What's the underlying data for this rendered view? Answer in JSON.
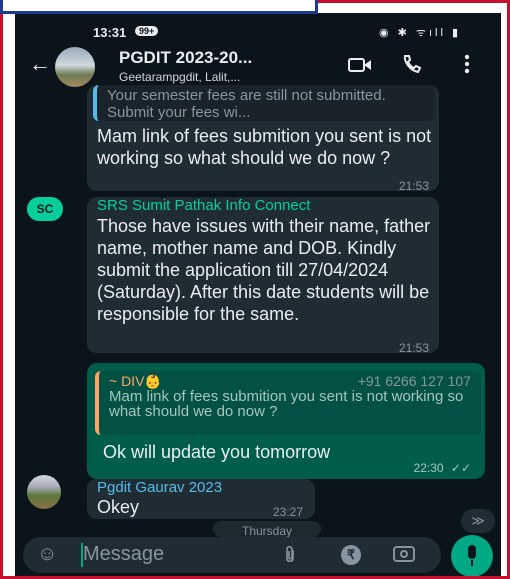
{
  "status_bar": {
    "time": "13:31",
    "badge": "99+",
    "icons": "◉ ✱ ᯤıll ▮"
  },
  "header": {
    "back_icon": "←",
    "title": "PGDIT 2023-20...",
    "subtitle": "Geetarampgdit, Lalit,...",
    "video_icon": "video-call-icon",
    "call_icon": "phone-icon",
    "menu_icon": "more-vertical-icon"
  },
  "messages": [
    {
      "direction": "incoming",
      "quote_text": "Your semester fees are still not submitted. Submit your fees wi...",
      "text": "Mam link of fees submition you sent is not working so what should we do now ?",
      "time": "21:53"
    },
    {
      "direction": "incoming",
      "avatar_initials": "SC",
      "sender": "SRS Sumit Pathak Info Connect",
      "text": "Those have issues with their name, father name, mother name and DOB. Kindly submit the application till 27/04/2024 (Saturday). After this date students will be responsible for the same.",
      "time": "21:53"
    },
    {
      "direction": "outgoing",
      "quote_sender": "~ DIV👶",
      "quote_phone": "+91 6266 127 107",
      "quote_text": "Mam link of fees submition you sent is not working so what should we do now ?",
      "text": "Ok will update you tomorrow",
      "time": "22:30",
      "ticks": "✓✓"
    },
    {
      "direction": "incoming",
      "sender": "Pgdit Gaurav 2023",
      "text": "Okey",
      "time": "23:27"
    }
  ],
  "day_chip": "Thursday",
  "scroll_down_icon": "≫",
  "input": {
    "placeholder": "Message",
    "emoji_icon": "☺",
    "attach_icon": "📎",
    "rupee_icon": "₹"
  },
  "colors": {
    "background": "#0b141a",
    "incoming_bubble": "#202c33",
    "outgoing_bubble": "#005c4b",
    "accent": "#00a884",
    "sender_srs": "#06cf9c",
    "sender_gaurav": "#53bdeb",
    "quote_sender": "#ffa366"
  }
}
